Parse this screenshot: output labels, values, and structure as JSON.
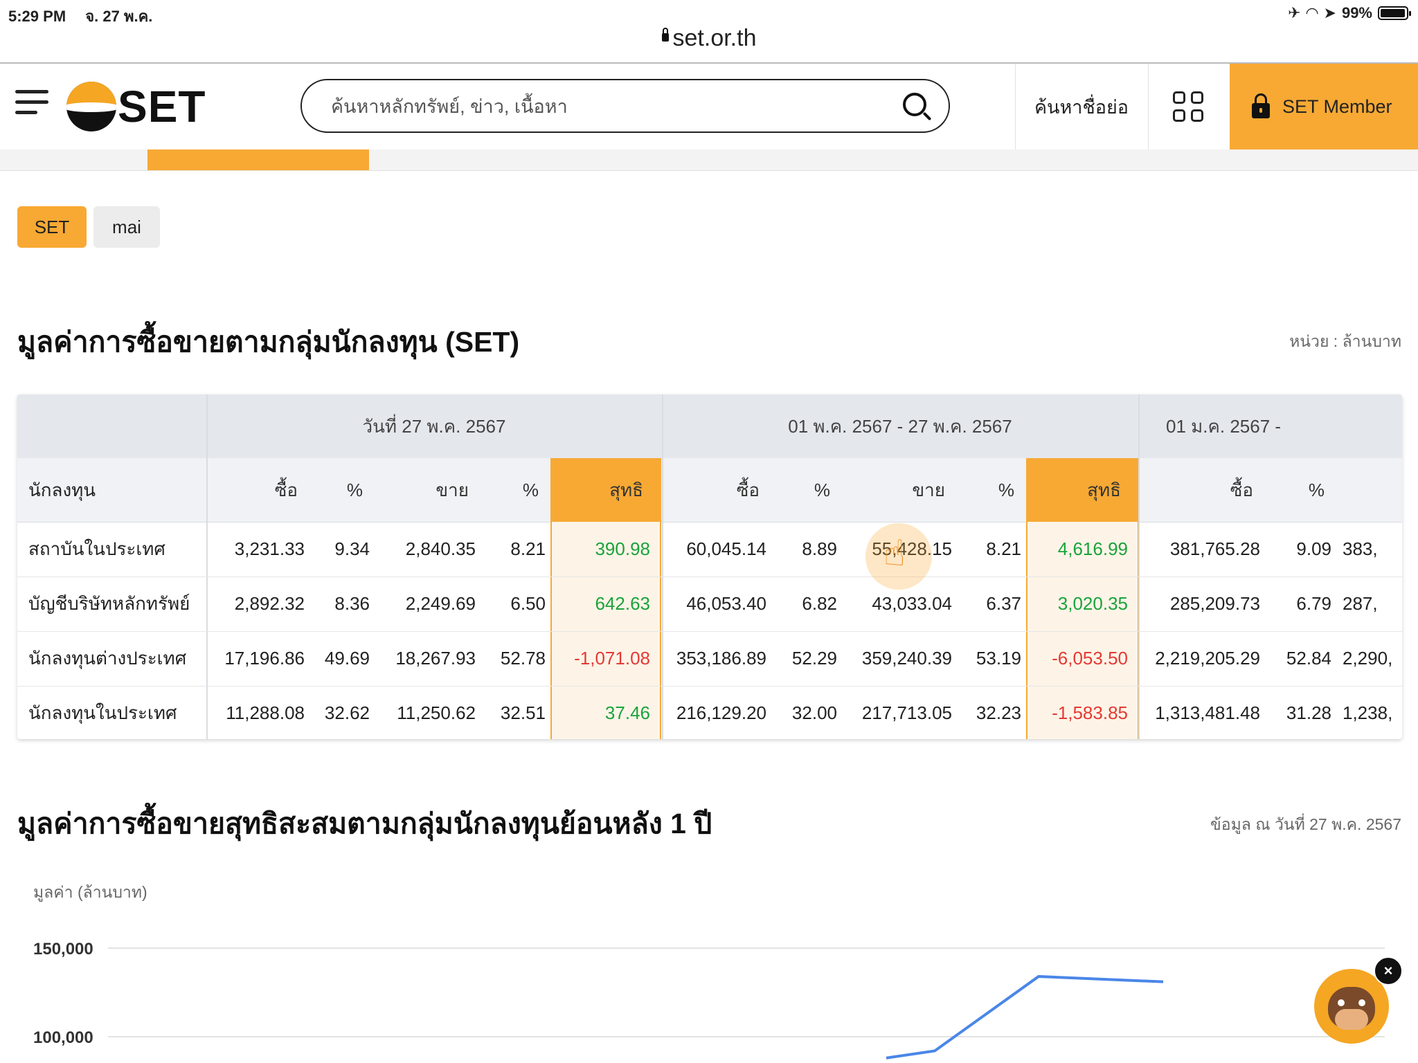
{
  "status_bar": {
    "time": "5:29 PM",
    "date": "จ. 27 พ.ค.",
    "battery": "99%"
  },
  "browser": {
    "url": "set.or.th"
  },
  "header": {
    "logo_text": "SET",
    "search_placeholder": "ค้นหาหลักทรัพย์, ข่าว, เนื้อหา",
    "symbol_search": "ค้นหาชื่อย่อ",
    "member_label": "SET Member"
  },
  "market_tabs": [
    "SET",
    "mai"
  ],
  "investor_table": {
    "title": "มูลค่าการซื้อขายตามกลุ่มนักลงทุน (SET)",
    "unit": "หน่วย : ล้านบาท",
    "investor_header": "นักลงทุน",
    "periods": [
      {
        "label": "วันที่ 27 พ.ค. 2567",
        "cols": [
          "ซื้อ",
          "%",
          "ขาย",
          "%",
          "สุทธิ"
        ]
      },
      {
        "label": "01 พ.ค. 2567 - 27 พ.ค. 2567",
        "cols": [
          "ซื้อ",
          "%",
          "ขาย",
          "%",
          "สุทธิ"
        ]
      },
      {
        "label": "01 ม.ค. 2567 -",
        "cols": [
          "ซื้อ",
          "%"
        ]
      }
    ],
    "rows": [
      {
        "name": "สถาบันในประเทศ",
        "values": [
          "3,231.33",
          "9.34",
          "2,840.35",
          "8.21",
          "390.98",
          "60,045.14",
          "8.89",
          "55,428.15",
          "8.21",
          "4,616.99",
          "381,765.28",
          "9.09",
          "383,"
        ]
      },
      {
        "name": "บัญชีบริษัทหลักทรัพย์",
        "values": [
          "2,892.32",
          "8.36",
          "2,249.69",
          "6.50",
          "642.63",
          "46,053.40",
          "6.82",
          "43,033.04",
          "6.37",
          "3,020.35",
          "285,209.73",
          "6.79",
          "287,"
        ]
      },
      {
        "name": "นักลงทุนต่างประเทศ",
        "values": [
          "17,196.86",
          "49.69",
          "18,267.93",
          "52.78",
          "-1,071.08",
          "353,186.89",
          "52.29",
          "359,240.39",
          "53.19",
          "-6,053.50",
          "2,219,205.29",
          "52.84",
          "2,290,"
        ]
      },
      {
        "name": "นักลงทุนในประเทศ",
        "values": [
          "11,288.08",
          "32.62",
          "11,250.62",
          "32.51",
          "37.46",
          "216,129.20",
          "32.00",
          "217,713.05",
          "32.23",
          "-1,583.85",
          "1,313,481.48",
          "31.28",
          "1,238,"
        ]
      }
    ]
  },
  "cumulative_chart": {
    "title": "มูลค่าการซื้อขายสุทธิสะสมตามกลุ่มนักลงทุนย้อนหลัง 1 ปี",
    "as_of": "ข้อมูล ณ วันที่ 27 พ.ค. 2567"
  },
  "chart_data": {
    "type": "line",
    "ylabel": "มูลค่า (ล้านบาท)",
    "yticks": [
      "150,000",
      "100,000"
    ],
    "series": [
      {
        "color": "#4a86e8",
        "points": [
          [
            0.9,
            88000
          ],
          [
            0.97,
            92000
          ],
          [
            1.12,
            134000
          ],
          [
            1.3,
            131000
          ]
        ]
      }
    ],
    "grid": true
  },
  "colors": {
    "accent": "#f7a934",
    "positive": "#1aa33b",
    "negative": "#e53935"
  }
}
